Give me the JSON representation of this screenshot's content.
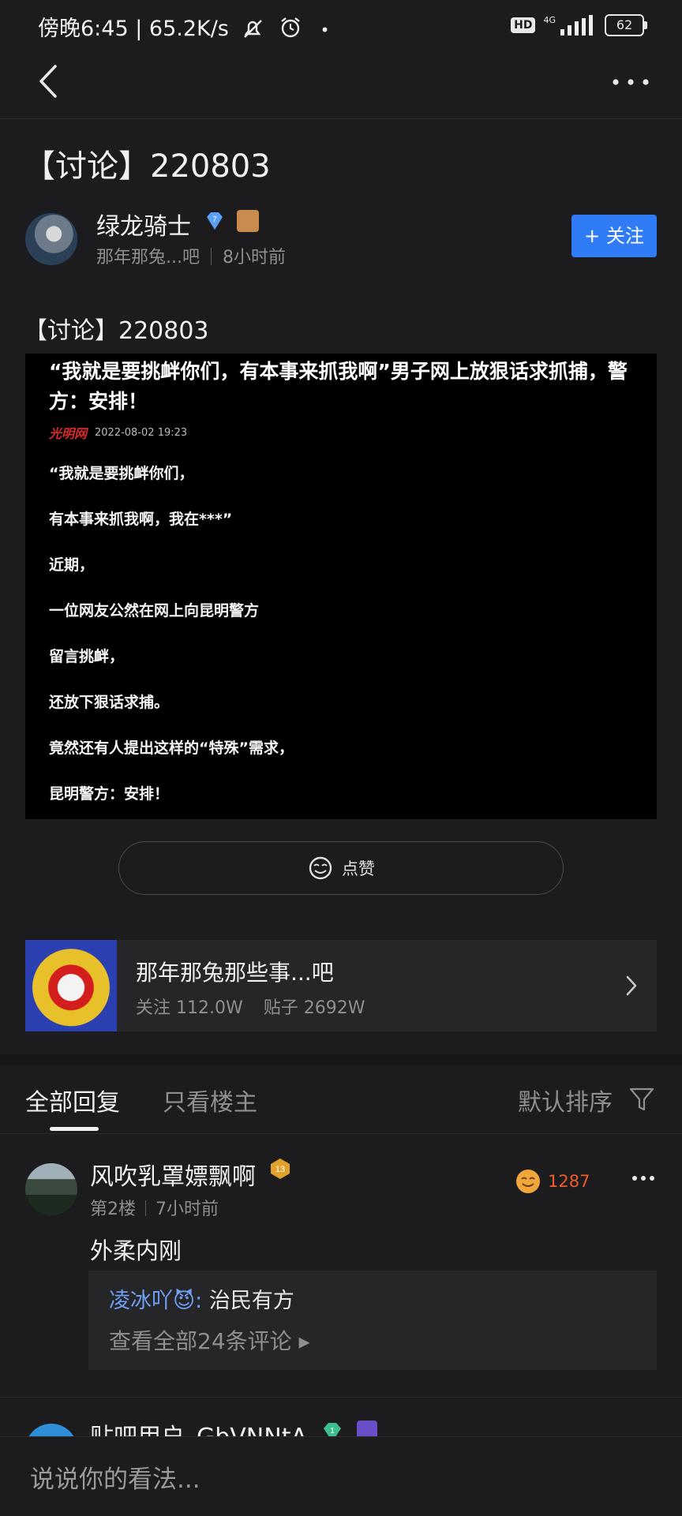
{
  "status_bar": {
    "time_speed": "傍晚6:45 | 65.2K/s",
    "hd": "HD",
    "network": "4G",
    "battery": "62"
  },
  "post": {
    "title": "【讨论】220803",
    "body": "【讨论】220803",
    "author": {
      "name": "绿龙骑士",
      "level": "7",
      "forum_short": "那年那兔...吧",
      "time": "8小时前"
    },
    "follow_label": "+ 关注",
    "image": {
      "headline": "“我就是要挑衅你们，有本事来抓我啊”男子网上放狠话求抓捕，警方：安排！",
      "source_logo": "光明网",
      "date": "2022-08-02 19:23",
      "lines": [
        "“我就是要挑衅你们，",
        "有本事来抓我啊，我在***”",
        "近期，",
        "一位网友公然在网上向昆明警方",
        "留言挑衅，",
        "还放下狠话求捕。",
        "竟然还有人提出这样的“特殊”需求，",
        "昆明警方：安排！"
      ]
    },
    "like_label": "点赞"
  },
  "forum": {
    "name": "那年那兔那些事...吧",
    "followers": "关注 112.0W",
    "posts": "贴子 2692W"
  },
  "tabs": {
    "all": "全部回复",
    "owner_only": "只看楼主",
    "sort": "默认排序"
  },
  "reply": {
    "name": "风吹乳罩嫖飘啊",
    "level": "13",
    "floor": "第2楼",
    "time": "7小时前",
    "like_count": "1287",
    "text": "外柔内刚",
    "sub_reply": {
      "user": "凌冰吖😈",
      "separator": ":",
      "text": "治民有方",
      "view_all": "查看全部24条评论 ▸"
    }
  },
  "next_reply": {
    "name": "贴吧用户_GbVNNtA",
    "level": "1"
  },
  "input": {
    "placeholder": "说说你的看法..."
  },
  "colors": {
    "background": "#1c1c1e",
    "accent": "#2f7cf6",
    "link": "#6e9ff2",
    "like": "#f25a2a"
  },
  "icons": [
    "back-icon",
    "more-icon",
    "diamond-icon",
    "like-icon",
    "chevron-right-icon",
    "filter-icon"
  ]
}
